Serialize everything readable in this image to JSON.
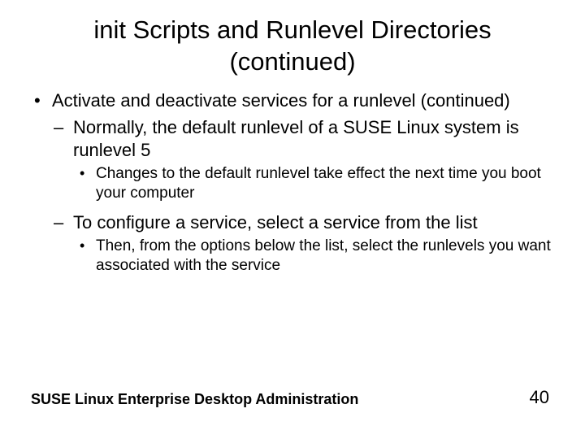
{
  "title_line1": "init Scripts and Runlevel Directories",
  "title_line2": "(continued)",
  "bullets": {
    "l1": "Activate and deactivate services for a runlevel (continued)",
    "l2a": "Normally, the default runlevel of a SUSE Linux system is runlevel 5",
    "l3a": "Changes to the default runlevel take effect the next time you boot your computer",
    "l2b": "To configure a service, select a service from the list",
    "l3b": "Then, from the options below the list, select the runlevels you want associated with the service"
  },
  "footer": {
    "left": "SUSE Linux Enterprise Desktop Administration",
    "page": "40"
  }
}
